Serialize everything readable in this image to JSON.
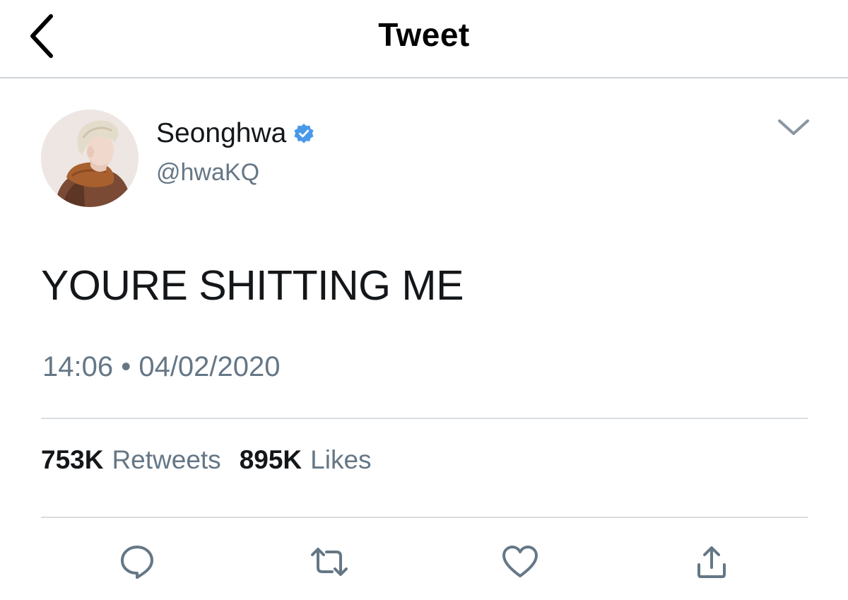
{
  "header": {
    "title": "Tweet",
    "back_icon": "chevron-left-icon"
  },
  "author": {
    "display_name": "Seonghwa",
    "verified": true,
    "handle": "@hwaKQ",
    "verified_color": "#4a99e9"
  },
  "tweet": {
    "text": "YOURE SHITTING ME",
    "timestamp": "14:06 • 04/02/2020"
  },
  "stats": {
    "retweets_count": "753K",
    "retweets_label": "Retweets",
    "likes_count": "895K",
    "likes_label": "Likes"
  },
  "actions": [
    {
      "name": "reply",
      "icon": "comment-icon"
    },
    {
      "name": "retweet",
      "icon": "retweet-icon"
    },
    {
      "name": "like",
      "icon": "heart-icon"
    },
    {
      "name": "share",
      "icon": "share-icon"
    }
  ],
  "colors": {
    "text_primary": "#14171a",
    "text_secondary": "#657786",
    "icon_gray": "#657786",
    "divider": "#dadde0"
  }
}
